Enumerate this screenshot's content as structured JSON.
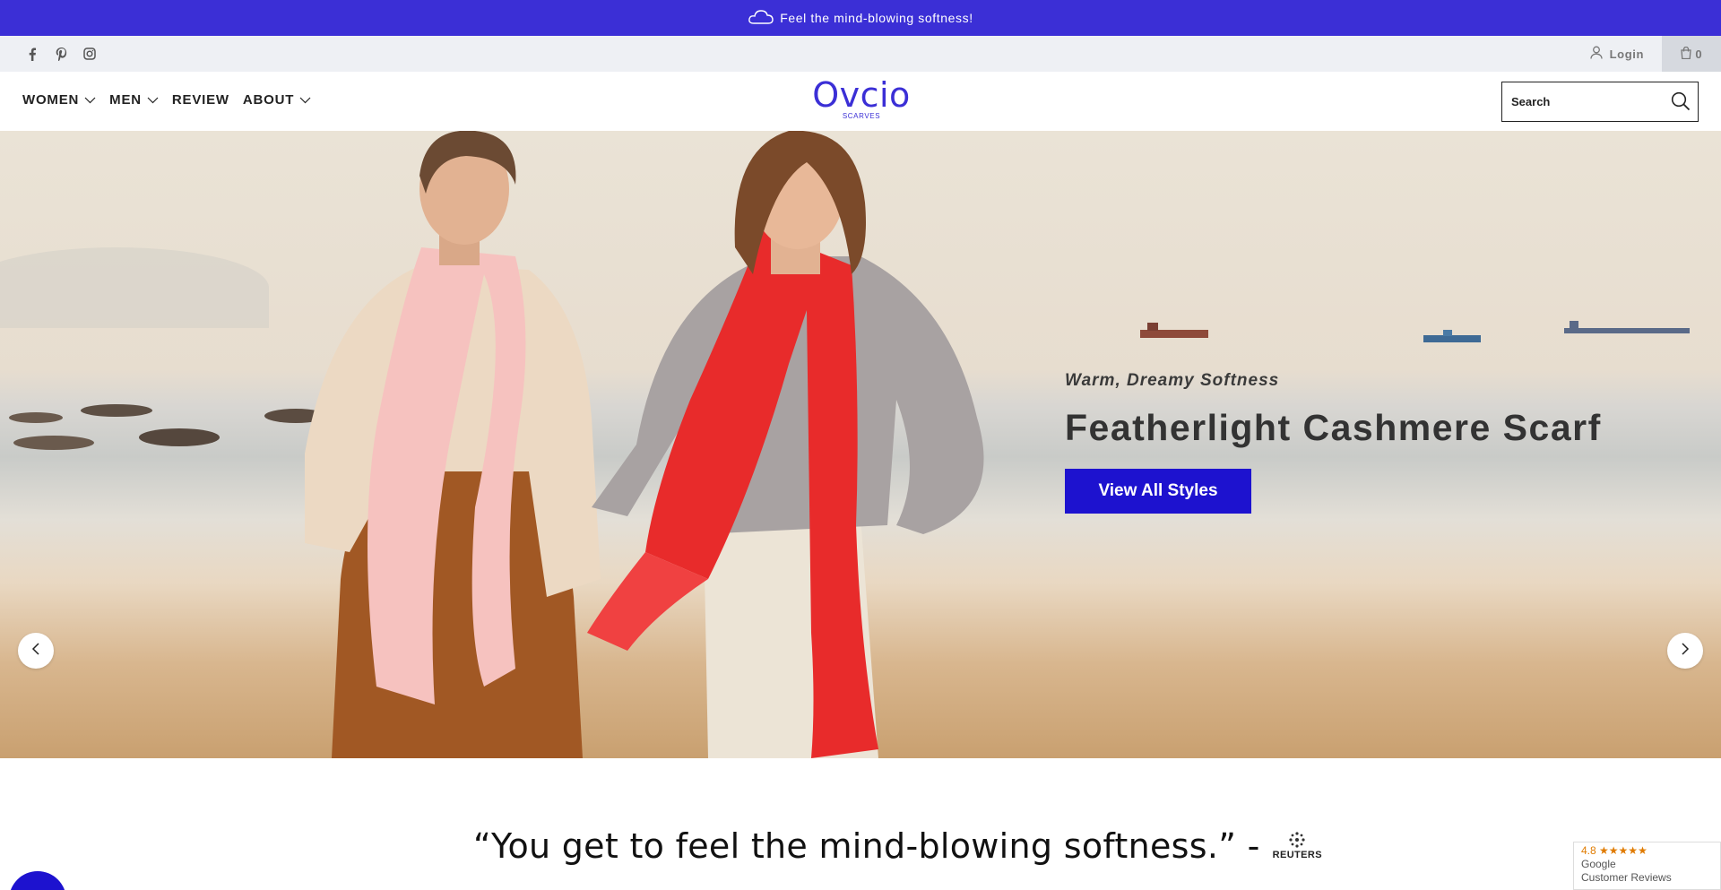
{
  "announcement": {
    "text": "Feel the mind-blowing softness!",
    "icon": "cloud-icon"
  },
  "utility": {
    "social": [
      "facebook-icon",
      "pinterest-icon",
      "instagram-icon"
    ],
    "login_label": "Login",
    "cart_count": "0"
  },
  "header": {
    "nav": [
      {
        "label": "WOMEN",
        "has_dropdown": true
      },
      {
        "label": "MEN",
        "has_dropdown": true
      },
      {
        "label": "REVIEW",
        "has_dropdown": false
      },
      {
        "label": "ABOUT",
        "has_dropdown": true
      }
    ],
    "logo": {
      "name": "Ovcio",
      "tagline": "SCARVES"
    },
    "search": {
      "placeholder": "Search",
      "value": ""
    }
  },
  "hero": {
    "kicker": "Warm, Dreamy Softness",
    "title": "Featherlight Cashmere Scarf",
    "cta_label": "View All Styles"
  },
  "quote": {
    "text": "“You get to feel the mind-blowing softness.” -",
    "source": "REUTERS"
  },
  "reviews_badge": {
    "rating": "4.8",
    "stars": "★★★★★",
    "line1": "Google",
    "line2": "Customer Reviews"
  },
  "colors": {
    "brand": "#3b2fd6",
    "cta": "#1d12cf",
    "utility_bg": "#eef0f4"
  }
}
